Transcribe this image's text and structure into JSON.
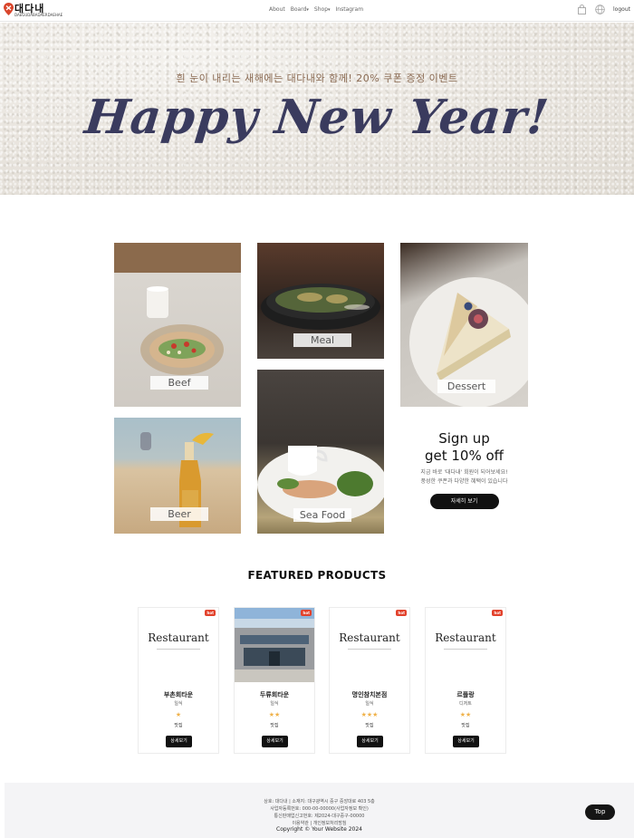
{
  "header": {
    "logo_text": "대다내",
    "logo_sub": "DAEGUDABADAERDAEHAE",
    "nav": [
      {
        "label": "About"
      },
      {
        "label": "Board",
        "caret": "▾"
      },
      {
        "label": "Shop",
        "caret": "▾"
      },
      {
        "label": "Instagram"
      }
    ],
    "logout_label": "logout",
    "brand_color": "#d9452b"
  },
  "hero": {
    "subtitle": "흰 눈이 내리는 새해에는 대다내와  함께!  20% 쿠폰 증정 이벤트",
    "title": "Happy New Year!"
  },
  "categories": [
    {
      "key": "beef",
      "label": "Beef"
    },
    {
      "key": "meal",
      "label": "Meal"
    },
    {
      "key": "dessert",
      "label": "Dessert"
    },
    {
      "key": "beer",
      "label": "Beer"
    },
    {
      "key": "seafood",
      "label": "Sea Food"
    }
  ],
  "signup": {
    "line1": "Sign up",
    "line2": "get 10% off",
    "desc1": "지금 바로 '대다내' 회원이 되어보세요!",
    "desc2": "풍성한 쿠폰과 다양한 혜택이 있습니다",
    "button": "자세히 보기"
  },
  "featured": {
    "title": "FEATURED PRODUCTS",
    "badge": "hot",
    "logo_text": "Restaurant",
    "button": "상세보기",
    "items": [
      {
        "name": "부촌회타운",
        "category": "일식",
        "stars": "★",
        "tag": "맛집",
        "has_photo": false
      },
      {
        "name": "두류회타운",
        "category": "일식",
        "stars": "★★",
        "tag": "맛집",
        "has_photo": true
      },
      {
        "name": "명인참치본점",
        "category": "일식",
        "stars": "★★★",
        "tag": "맛집",
        "has_photo": false
      },
      {
        "name": "르플랑",
        "category": "디저트",
        "stars": "★★",
        "tag": "맛집",
        "has_photo": false
      }
    ]
  },
  "footer": {
    "line1": "상호: 대다내 | 소재지: 대구광역시 중구 중앙대로 403 5층",
    "line2": "사업자등록번호: 000-00-00000(사업자정보 확인)",
    "line3": "통신판매업신고번호: 제2024-대구중구-00000",
    "line4": "이용약관 | 개인정보처리방침",
    "copyright": "Copyright © Your Website 2024",
    "top_button": "Top"
  }
}
